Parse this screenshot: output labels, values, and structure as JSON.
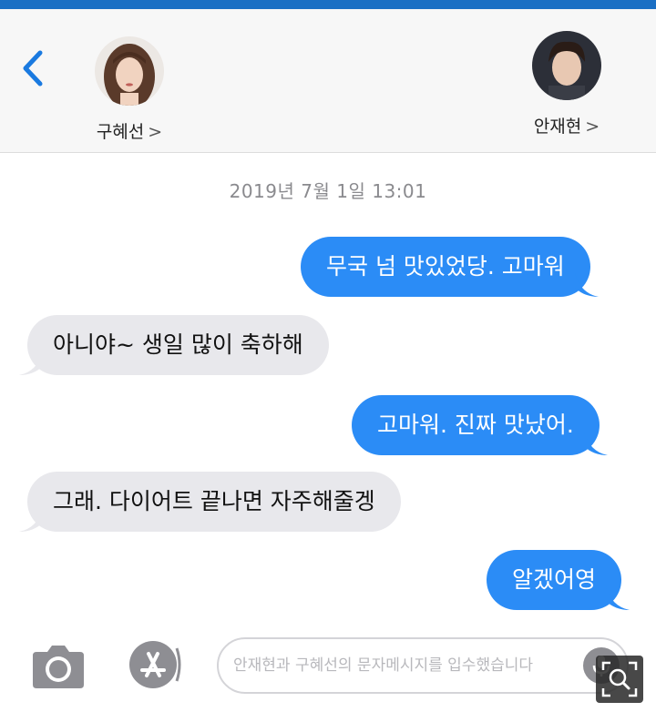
{
  "header": {
    "back_icon": "chevron-left-icon",
    "contacts": [
      {
        "name": "구혜선",
        "chevron": ">"
      },
      {
        "name": "안재현",
        "chevron": ">"
      }
    ]
  },
  "timestamp": "2019년 7월 1일  13:01",
  "messages": [
    {
      "direction": "sent",
      "text": "무국 넘 맛있었당. 고마워"
    },
    {
      "direction": "received",
      "text": "아니야~ 생일 많이 축하해"
    },
    {
      "direction": "sent",
      "text": "고마워. 진짜 맛났어."
    },
    {
      "direction": "received",
      "text": "그래. 다이어트 끝나면 자주해줄겡"
    },
    {
      "direction": "sent",
      "text": "알겠어영"
    }
  ],
  "composer": {
    "placeholder": "안재현과 구혜선의 문자메시지를 입수했습니다",
    "camera_icon": "camera-icon",
    "appstore_icon": "app-store-icon",
    "mic_icon": "microphone-icon"
  },
  "overlay": {
    "zoom_icon": "zoom-icon"
  },
  "colors": {
    "sent_bubble": "#2b8cf6",
    "received_bubble": "#e8e8ec",
    "accent": "#1a6fc4"
  }
}
